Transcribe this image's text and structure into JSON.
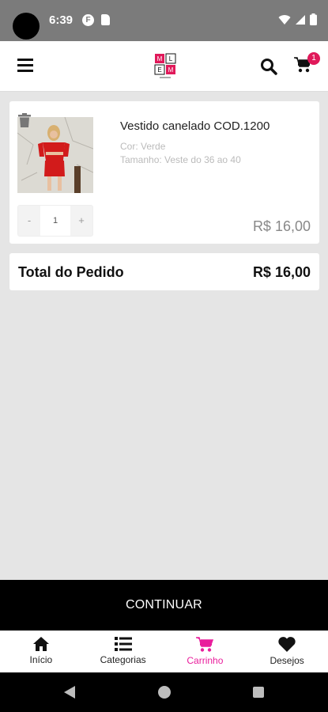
{
  "status_bar": {
    "time": "6:39",
    "notification_letter": "F"
  },
  "header": {
    "cart_count": "1",
    "logo_letters": [
      "M",
      "L",
      "E",
      "M"
    ]
  },
  "cart": {
    "item": {
      "name": "Vestido canelado COD.1200",
      "color": "Cor: Verde",
      "size": "Tamanho: Veste do 36 ao 40",
      "quantity": "1",
      "minus": "-",
      "plus": "+",
      "price": "R$  16,00"
    },
    "total_label": "Total do Pedido",
    "total_value": "R$  16,00"
  },
  "continue_label": "CONTINUAR",
  "bottom_nav": {
    "items": [
      {
        "label": "Início",
        "icon": "home-icon"
      },
      {
        "label": "Categorias",
        "icon": "list-icon"
      },
      {
        "label": "Carrinho",
        "icon": "cart-icon"
      },
      {
        "label": "Desejos",
        "icon": "heart-icon"
      }
    ],
    "active_index": 2
  },
  "colors": {
    "accent": "#e91e9c",
    "badge": "#e0195a",
    "dark": "#000000"
  }
}
